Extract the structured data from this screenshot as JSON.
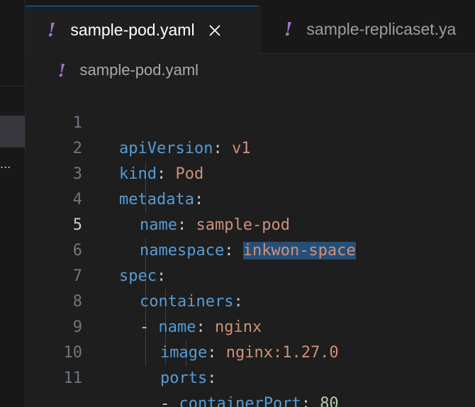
{
  "tabs": [
    {
      "label": "sample-pod.yaml",
      "active": true,
      "icon": "yaml-icon"
    },
    {
      "label": "sample-replicaset.ya",
      "active": false,
      "icon": "yaml-icon"
    }
  ],
  "sidebar": {
    "truncated_text": "..."
  },
  "breadcrumb": {
    "file": "sample-pod.yaml",
    "icon": "yaml-icon",
    "icon_glyph": "!"
  },
  "editor": {
    "current_line": 5,
    "lines": [
      {
        "no": "1",
        "key": "apiVersion",
        "sep": ":",
        "value": "v1"
      },
      {
        "no": "2",
        "key": "kind",
        "sep": ":",
        "value": "Pod"
      },
      {
        "no": "3",
        "key": "metadata",
        "sep": ":"
      },
      {
        "no": "4",
        "key": "name",
        "sep": ":",
        "value": "sample-pod"
      },
      {
        "no": "5",
        "key": "namespace",
        "sep": ":",
        "value": "inkwon-space"
      },
      {
        "no": "6",
        "key": "spec",
        "sep": ":"
      },
      {
        "no": "7",
        "key": "containers",
        "sep": ":"
      },
      {
        "no": "8",
        "dash": "-",
        "key": "name",
        "sep": ":",
        "value": "nginx"
      },
      {
        "no": "9",
        "key": "image",
        "sep": ":",
        "value": "nginx:1.27.0"
      },
      {
        "no": "10",
        "key": "ports",
        "sep": ":"
      },
      {
        "no": "11",
        "dash": "-",
        "key": "containerPort",
        "sep": ":",
        "value": "80"
      }
    ]
  },
  "colors": {
    "key": "#569cd6",
    "string": "#ce9178",
    "number": "#b5cea8",
    "yaml_icon": "#a074c4",
    "selection": "#264f78",
    "accent": "#0078d4"
  }
}
